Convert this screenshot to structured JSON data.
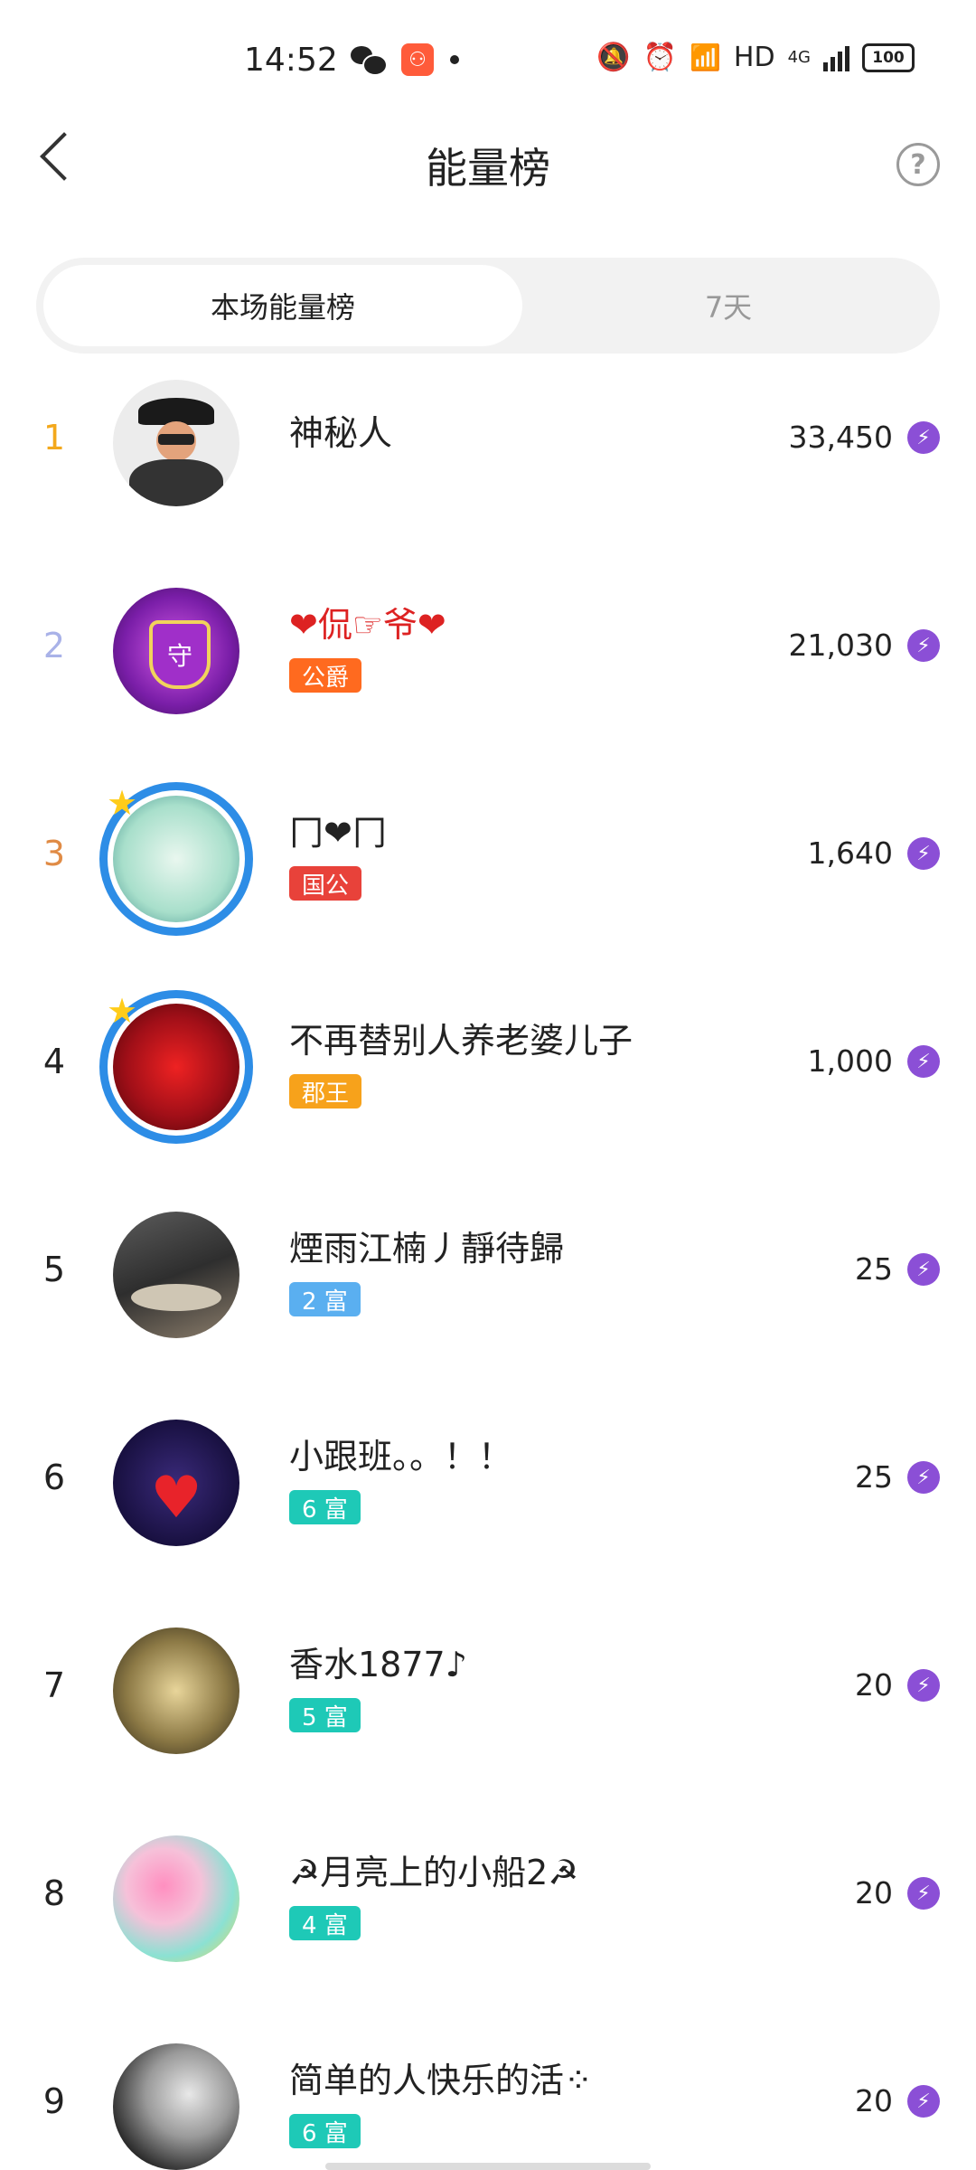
{
  "status_bar": {
    "time": "14:52",
    "network": "HD",
    "net_type": "4G",
    "battery": "100"
  },
  "header": {
    "title": "能量榜",
    "help": "?"
  },
  "tabs": [
    {
      "label": "本场能量榜",
      "active": true
    },
    {
      "label": "7天",
      "active": false
    }
  ],
  "ranking": [
    {
      "rank": "1",
      "name": "神秘人",
      "badge": "",
      "score": "33,450"
    },
    {
      "rank": "2",
      "name": "❤侃☞爷❤",
      "badge": "公爵",
      "score": "21,030"
    },
    {
      "rank": "3",
      "name": "冂❤冂",
      "badge": "国公",
      "score": "1,640"
    },
    {
      "rank": "4",
      "name": "不再替别人养老婆儿子",
      "badge": "郡王",
      "score": "1,000"
    },
    {
      "rank": "5",
      "name": "煙雨江楠丿靜待歸",
      "badge": "2 富",
      "score": "25"
    },
    {
      "rank": "6",
      "name": "小跟班。。！！",
      "badge": "6 富",
      "score": "25"
    },
    {
      "rank": "7",
      "name": "香水1877♪",
      "badge": "5 富",
      "score": "20"
    },
    {
      "rank": "8",
      "name": "☭月亮上的小船2☭",
      "badge": "4 富",
      "score": "20"
    },
    {
      "rank": "9",
      "name": "简单的人快乐的活⁘",
      "badge": "6 富",
      "score": "20"
    }
  ],
  "colors": {
    "rank1": "#f3a81c",
    "rank2": "#a9b2e8",
    "rank3": "#e08b45",
    "badge_orange": "#ff6a1f",
    "badge_red": "#e8423a",
    "badge_gold": "#f7a21b",
    "badge_blue": "#5aaff0",
    "badge_teal": "#1ec9b7",
    "energy_icon": "#8b4fd6"
  }
}
